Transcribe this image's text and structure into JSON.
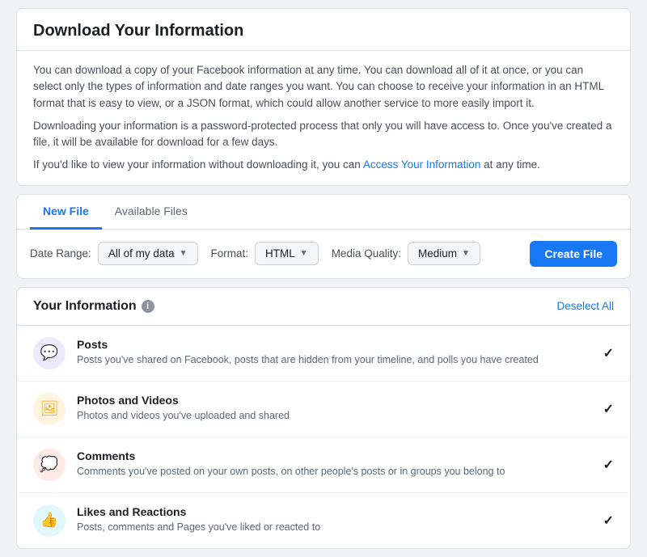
{
  "page": {
    "title": "Download Your Information",
    "description1": "You can download a copy of your Facebook information at any time. You can download all of it at once, or you can select only the types of information and date ranges you want. You can choose to receive your information in an HTML format that is easy to view, or a JSON format, which could allow another service to more easily import it.",
    "description2": "Downloading your information is a password-protected process that only you will have access to. Once you've created a file, it will be available for download for a few days.",
    "description3_pre": "If you'd like to view your information without downloading it, you can ",
    "description3_link": "Access Your Information",
    "description3_post": " at any time."
  },
  "tabs": [
    {
      "label": "New File",
      "active": true
    },
    {
      "label": "Available Files",
      "active": false
    }
  ],
  "controls": {
    "date_range_label": "Date Range:",
    "date_range_value": "All of my data",
    "format_label": "Format:",
    "format_value": "HTML",
    "media_quality_label": "Media Quality:",
    "media_quality_value": "Medium",
    "create_button_label": "Create File"
  },
  "your_information": {
    "title": "Your Information",
    "deselect_all": "Deselect All",
    "items": [
      {
        "icon_color": "#7b68ee",
        "icon_bg": "#ede9ff",
        "icon_symbol": "💬",
        "title": "Posts",
        "description": "Posts you've shared on Facebook, posts that are hidden from your timeline, and polls you have created",
        "checked": true
      },
      {
        "icon_color": "#f5a623",
        "icon_bg": "#fff4de",
        "icon_symbol": "🖼",
        "title": "Photos and Videos",
        "description": "Photos and videos you've uploaded and shared",
        "checked": true
      },
      {
        "icon_color": "#e8472a",
        "icon_bg": "#ffeae7",
        "icon_symbol": "💭",
        "title": "Comments",
        "description": "Comments you've posted on your own posts, on other people's posts or in groups you belong to",
        "checked": true
      },
      {
        "icon_color": "#00b8d9",
        "icon_bg": "#e0f7fc",
        "icon_symbol": "👍",
        "title": "Likes and Reactions",
        "description": "Posts, comments and Pages you've liked or reacted to",
        "checked": true
      }
    ]
  }
}
